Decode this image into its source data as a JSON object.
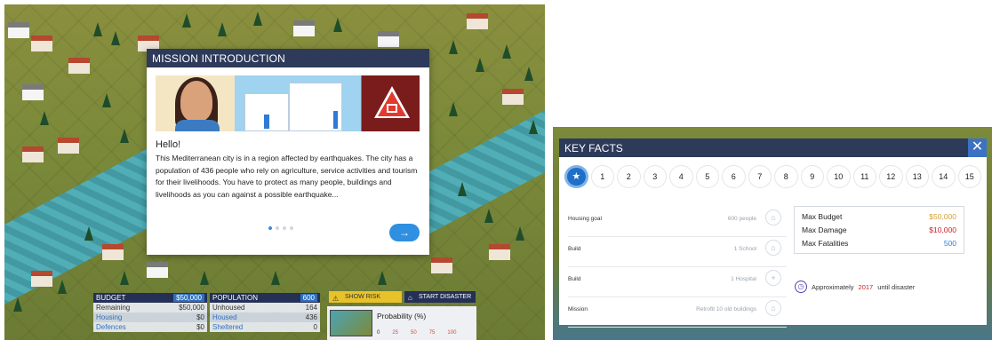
{
  "mission": {
    "title": "MISSION INTRODUCTION",
    "greeting": "Hello!",
    "text": "This Mediterranean city is in a region affected by earthquakes. The city has a population of 436 people who rely on agriculture, service activities and tourism for their livelihoods. You have to protect as many people, buildings and livelihoods as you can against a possible earthquake...",
    "next_label": "→",
    "page_dots": 4,
    "active_dot": 0
  },
  "hud": {
    "budget": {
      "label": "BUDGET",
      "value": "$50,000",
      "rows": [
        {
          "label": "Remaining",
          "value": "$50,000"
        },
        {
          "label": "Housing",
          "value": "$0"
        },
        {
          "label": "Defences",
          "value": "$0"
        }
      ]
    },
    "population": {
      "label": "POPULATION",
      "value": "600",
      "rows": [
        {
          "label": "Unhoused",
          "value": "164"
        },
        {
          "label": "Housed",
          "value": "436"
        },
        {
          "label": "Sheltered",
          "value": "0"
        }
      ]
    },
    "show_risk": "SHOW RISK",
    "start_disaster": "START DISASTER",
    "probability": {
      "title": "Probability (%)",
      "ticks": [
        "0",
        "25",
        "50",
        "75",
        "100"
      ]
    }
  },
  "key_facts": {
    "title": "KEY FACTS",
    "close": "✕",
    "steps": [
      "★",
      "1",
      "2",
      "3",
      "4",
      "5",
      "6",
      "7",
      "8",
      "9",
      "10",
      "11",
      "12",
      "13",
      "14",
      "15"
    ],
    "rows": [
      {
        "label": "Housing goal",
        "value": "600 people",
        "icon": "⌂"
      },
      {
        "label": "Build",
        "value": "1 School",
        "icon": "⌂"
      },
      {
        "label": "Build",
        "value": "1 Hospital",
        "icon": "+"
      },
      {
        "label": "Mission",
        "value": "Retrofit 10 old buildings",
        "icon": "⌂"
      }
    ],
    "stats": [
      {
        "label": "Max Budget",
        "value": "$50,000",
        "color": "#d3a13a"
      },
      {
        "label": "Max Damage",
        "value": "$10,000",
        "color": "#c4242a"
      },
      {
        "label": "Max Fatalities",
        "value": "500",
        "color": "#2f7fd0"
      }
    ],
    "note": {
      "prefix": "Approximately",
      "year": "2017",
      "suffix": "until disaster"
    }
  }
}
